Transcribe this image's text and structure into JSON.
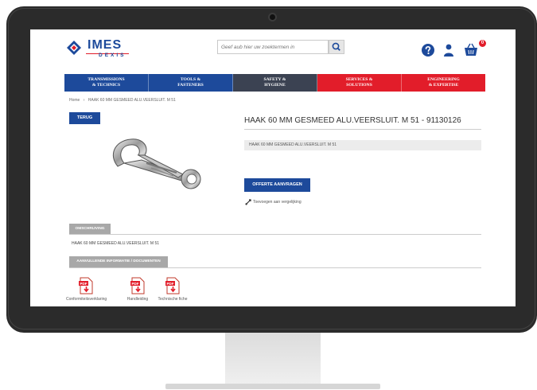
{
  "header": {
    "logo_text": "IMES",
    "logo_sub": "DEXIS",
    "search_placeholder": "Geef aub hier uw zoektermen in",
    "cart_count": "0"
  },
  "nav": [
    {
      "line1": "TRANSMISSIONS",
      "line2": "& TECHNICS",
      "color": "#1d4a9b"
    },
    {
      "line1": "TOOLS &",
      "line2": "FASTENERS",
      "color": "#1d4a9b"
    },
    {
      "line1": "SAFETY &",
      "line2": "HYGIENE",
      "color": "#3b4252"
    },
    {
      "line1": "SERVICES &",
      "line2": "SOLUTIONS",
      "color": "#e21d2a"
    },
    {
      "line1": "ENGINEERING",
      "line2": "& EXPERTISE",
      "color": "#e21d2a"
    }
  ],
  "breadcrumb": {
    "home": "Home",
    "sep": "›",
    "current": "HAAK 60 MM GESMEED ALU.VEERSLUIT. M 51"
  },
  "product": {
    "back_label": "TERUG",
    "title": "HAAK 60 MM GESMEED ALU.VEERSLUIT. M 51 - 91130126",
    "short_desc": "HAAK 60 MM GESMEED ALU.VEERSLUIT. M 51",
    "quote_label": "OFFERTE AANVRAGEN",
    "compare_label": "Toevoegen aan vergelijking"
  },
  "description": {
    "tab_label": "OMSCHRIJVING",
    "text": "HAAK 60 MM GESMEED ALU.VEERSLUIT. M 51"
  },
  "documents": {
    "tab_label": "AANVULLENDE INFORMATIE / DOCUMENTEN",
    "items": [
      {
        "label": "Conformiteitsverklaring",
        "icon": "pdf-icon"
      },
      {
        "label": "Handleiding",
        "icon": "pdf-icon"
      },
      {
        "label": "Technische fiche",
        "icon": "pdf-icon"
      }
    ]
  },
  "colors": {
    "brand_blue": "#1d4a9b",
    "brand_red": "#e21d2a",
    "nav_dark": "#3b4252"
  }
}
